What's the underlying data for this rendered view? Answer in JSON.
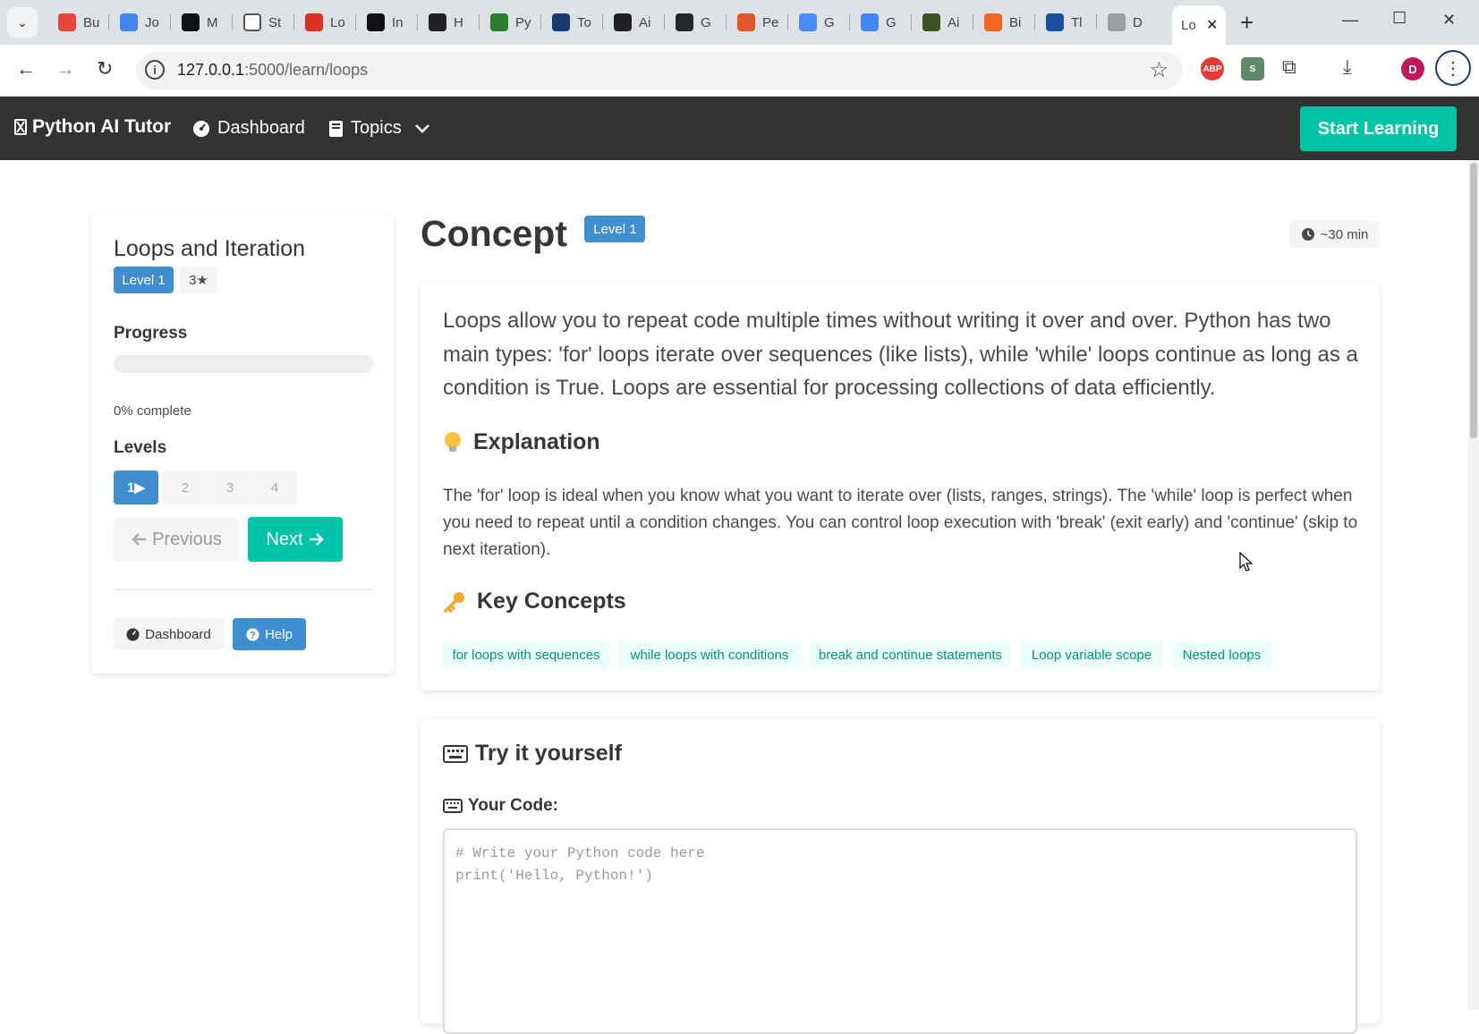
{
  "browser": {
    "tabs": [
      {
        "title": "Bu",
        "fav": "#e8453c"
      },
      {
        "title": "Jo",
        "fav": "#4285f4"
      },
      {
        "title": "M",
        "fav": "#111111"
      },
      {
        "title": "St",
        "fav": "#ffffff"
      },
      {
        "title": "Lo",
        "fav": "#d93025"
      },
      {
        "title": "In",
        "fav": "#111111"
      },
      {
        "title": "H",
        "fav": "#222222"
      },
      {
        "title": "Py",
        "fav": "#2e7d32"
      },
      {
        "title": "To",
        "fav": "#1a3a6e"
      },
      {
        "title": "Ai",
        "fav": "#222222"
      },
      {
        "title": "G",
        "fav": "#24292f"
      },
      {
        "title": "Pe",
        "fav": "#e0572b"
      },
      {
        "title": "G",
        "fav": "#4a8cf7"
      },
      {
        "title": "G",
        "fav": "#4285f4"
      },
      {
        "title": "Ai",
        "fav": "#3b5323"
      },
      {
        "title": "Bi",
        "fav": "#f26522"
      },
      {
        "title": "Tl",
        "fav": "#1a4fa0"
      },
      {
        "title": "D",
        "fav": "#9aa0a6"
      }
    ],
    "active_tab_title": "Lo",
    "url_host": "127.0.0.1",
    "url_path": ":5000/learn/loops",
    "profile_initial": "D",
    "abp_label": "ABP"
  },
  "navbar": {
    "brand": "Python AI Tutor",
    "dashboard": "Dashboard",
    "topics": "Topics",
    "start_learning": "Start Learning"
  },
  "sidebar": {
    "title": "Loops and Iteration",
    "level_tag": "Level 1",
    "stars_tag": "3★",
    "progress_heading": "Progress",
    "progress_value": 0,
    "progress_text": "0% complete",
    "levels_heading": "Levels",
    "levels": [
      "1▶",
      "2",
      "3",
      "4"
    ],
    "previous": "Previous",
    "next": "Next",
    "dashboard_btn": "Dashboard",
    "help_btn": "Help"
  },
  "main": {
    "title": "Concept",
    "level_tag": "Level 1",
    "time": "~30 min",
    "lead": "Loops allow you to repeat code multiple times without writing it over and over. Python has two main types: 'for' loops iterate over sequences (like lists), while 'while' loops continue as long as a condition is True. Loops are essential for processing collections of data efficiently.",
    "explanation_heading": "Explanation",
    "explanation": "The 'for' loop is ideal when you know what you want to iterate over (lists, ranges, strings). The 'while' loop is perfect when you need to repeat until a condition changes. You can control loop execution with 'break' (exit early) and 'continue' (skip to next iteration).",
    "key_concepts_heading": "Key Concepts",
    "key_concepts": [
      "for loops with sequences",
      "while loops with conditions",
      "break and continue statements",
      "Loop variable scope",
      "Nested loops"
    ],
    "try_heading": "Try it yourself",
    "your_code_label": "Your Code:",
    "code_placeholder": "# Write your Python code here\nprint('Hello, Python!')"
  },
  "colors": {
    "accent_teal": "#00c4a7",
    "accent_blue": "#3e8ed0",
    "navbar_bg": "#333333"
  }
}
